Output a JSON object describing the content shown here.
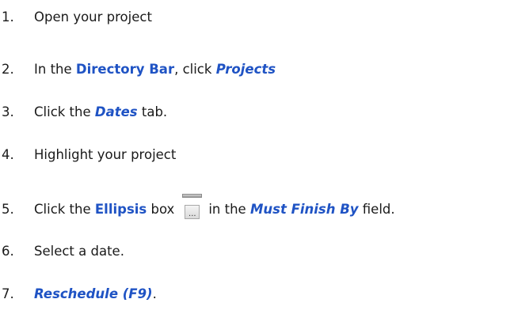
{
  "steps": [
    {
      "number": "1.",
      "text": "Open your project"
    },
    {
      "number": "2.",
      "before": "In the ",
      "highlight": "Directory Bar",
      "middle": ", click ",
      "highlight2": "Projects"
    },
    {
      "number": "3.",
      "before": "Click the ",
      "highlight": "Dates",
      "after": " tab."
    },
    {
      "number": "4.",
      "text": "Highlight your project"
    },
    {
      "number": "5.",
      "before": "Click the ",
      "highlight": "Ellipsis",
      "middle": " box",
      "button_label": "...",
      "middle2": "in the ",
      "highlight2": "Must Finish By",
      "after": " field."
    },
    {
      "number": "6.",
      "text": "Select a date."
    },
    {
      "number": "7.",
      "highlight": "Reschedule (F9)",
      "after": "."
    }
  ],
  "colors": {
    "highlight": "#1f53c4",
    "text": "#1a1a1a"
  },
  "icons": {
    "ellipsis_button": "ellipsis-button-icon"
  }
}
